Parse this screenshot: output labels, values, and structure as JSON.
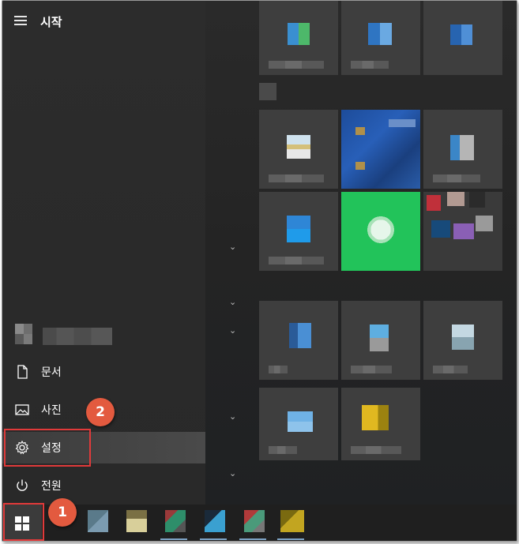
{
  "start_menu": {
    "title": "시작",
    "menu_items": [
      {
        "key": "documents",
        "label": "문서"
      },
      {
        "key": "pictures",
        "label": "사진"
      },
      {
        "key": "settings",
        "label": "설정"
      },
      {
        "key": "power",
        "label": "전원"
      }
    ]
  },
  "annotations": {
    "step1": "1",
    "step2": "2"
  },
  "icons": {
    "hamburger": "hamburger-menu-icon",
    "documents": "document-icon",
    "pictures": "picture-icon",
    "settings": "gear-icon",
    "power": "power-icon",
    "windows": "windows-logo-icon",
    "chevron": "chevron-down-icon"
  },
  "colors": {
    "accent_red": "#e03a3a",
    "badge": "#e35a3f",
    "green_tile": "#22c35a",
    "taskbar": "#1f1f1f"
  }
}
